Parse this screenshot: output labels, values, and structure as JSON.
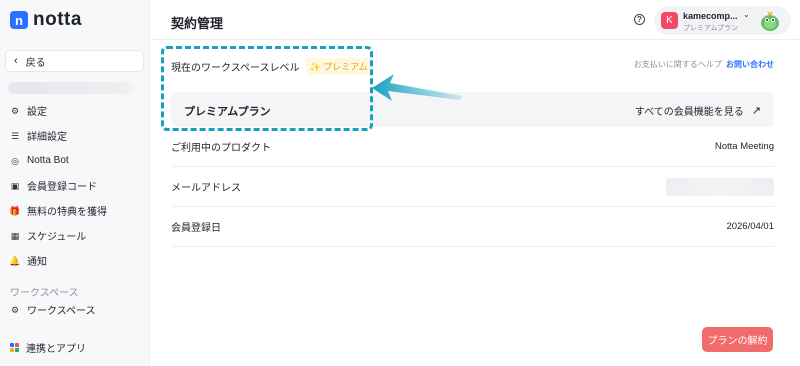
{
  "brand": {
    "name": "notta",
    "logo_letter": "n"
  },
  "sidebar": {
    "back_label": "戻る",
    "items": [
      {
        "icon": "gear-icon",
        "glyph": "⚙",
        "label": "設定"
      },
      {
        "icon": "sliders-icon",
        "glyph": "☰",
        "label": "詳細設定"
      },
      {
        "icon": "bot-icon",
        "glyph": "◎",
        "label": "Notta Bot"
      },
      {
        "icon": "code-icon",
        "glyph": "▣",
        "label": "会員登録コード"
      },
      {
        "icon": "gift-icon",
        "glyph": "🎁",
        "label": "無料の特典を獲得"
      },
      {
        "icon": "calendar-icon",
        "glyph": "▦",
        "label": "スケジュール"
      },
      {
        "icon": "bell-icon",
        "glyph": "🔔",
        "label": "通知"
      }
    ],
    "section_label": "ワークスペース",
    "workspace_item": {
      "icon": "gear-icon",
      "glyph": "⚙",
      "label": "ワークスペース"
    },
    "integrations_item": {
      "icon": "apps-grid-icon",
      "label": "連携とアプリ"
    }
  },
  "header": {
    "title": "契約管理",
    "help_glyph": "?",
    "account": {
      "avatar_letter": "K",
      "name": "kamecomp...",
      "plan": "プレミアムプラン",
      "chevron": "⌄"
    }
  },
  "main": {
    "ws_level_label": "現在のワークスペースレベル",
    "ws_level_badge": "✨ プレミアム",
    "help_text": "お支払いに関するヘルプ",
    "help_link": "お問い合わせ",
    "plan_name": "プレミアムプラン",
    "plan_features_label": "すべての会員機能を見る",
    "plan_features_arrow": "↗",
    "rows": [
      {
        "label": "ご利用中のプロダクト",
        "value": "Notta Meeting"
      },
      {
        "label": "メールアドレス",
        "value": ""
      },
      {
        "label": "会員登録日",
        "value": "2026/04/01"
      }
    ],
    "cancel_label": "プランの解約"
  },
  "colors": {
    "accent": "#2b6fff",
    "annotation": "#16a0c0",
    "danger": "#f26b6b",
    "badge_text": "#e6a100",
    "avatar": "#ef4b67"
  }
}
